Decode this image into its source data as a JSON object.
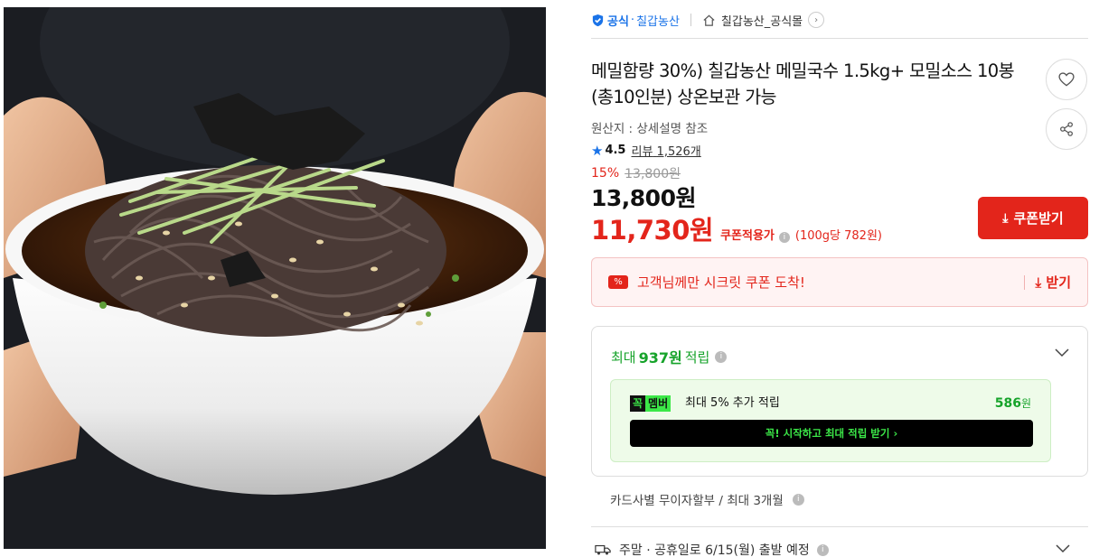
{
  "product_image": {
    "alt": "메밀국수"
  },
  "seller": {
    "official_label": "공식",
    "dot": "·",
    "brand": "칠갑농산",
    "mall": "칠갑농산_공식몰",
    "icons": {
      "badge": "shield-check-icon",
      "store": "home-icon",
      "go": "chevron-right-icon"
    }
  },
  "product": {
    "title": "메밀함량 30%) 칠갑농산 메밀국수 1.5kg+ 모밀소스 10봉 (총10인분) 상온보관 가능",
    "origin": "원산지 : 상세설명 참조",
    "rating": "4.5",
    "review_label": "리뷰",
    "review_count": "1,526개"
  },
  "actions": {
    "wishlist_icon": "heart-icon",
    "share_icon": "share-icon"
  },
  "price": {
    "discount_pct": "15%",
    "list_price": "13,800원",
    "sale_price": "13,800원",
    "coupon_price": "11,730원",
    "coupon_label": "쿠폰적용가",
    "unit_price": "(100g당 782원)",
    "coupon_button": "쿠폰받기"
  },
  "secret_coupon": {
    "icon_text": "%",
    "text": "고객님께만 시크릿 쿠폰 도착!",
    "action": "받기"
  },
  "points": {
    "prefix": "최대",
    "amount": "937원",
    "suffix": "적립",
    "member": {
      "badge_left": "꼭",
      "badge_right": "멤버",
      "text": "최대 5% 추가 적립",
      "points": "586",
      "points_unit": "원",
      "cta": "꼭! 시작하고 최대 적립 받기  ›"
    }
  },
  "installment": "카드사별 무이자할부 / 최대 3개월",
  "shipping": {
    "icon": "truck-icon",
    "text": "주말 · 공휴일로 6/15(월) 출발 예정"
  },
  "colors": {
    "accent_red": "#e3251b",
    "point_green": "#16a32a",
    "link_blue": "#1a73e8",
    "member_green": "#3ce848"
  }
}
